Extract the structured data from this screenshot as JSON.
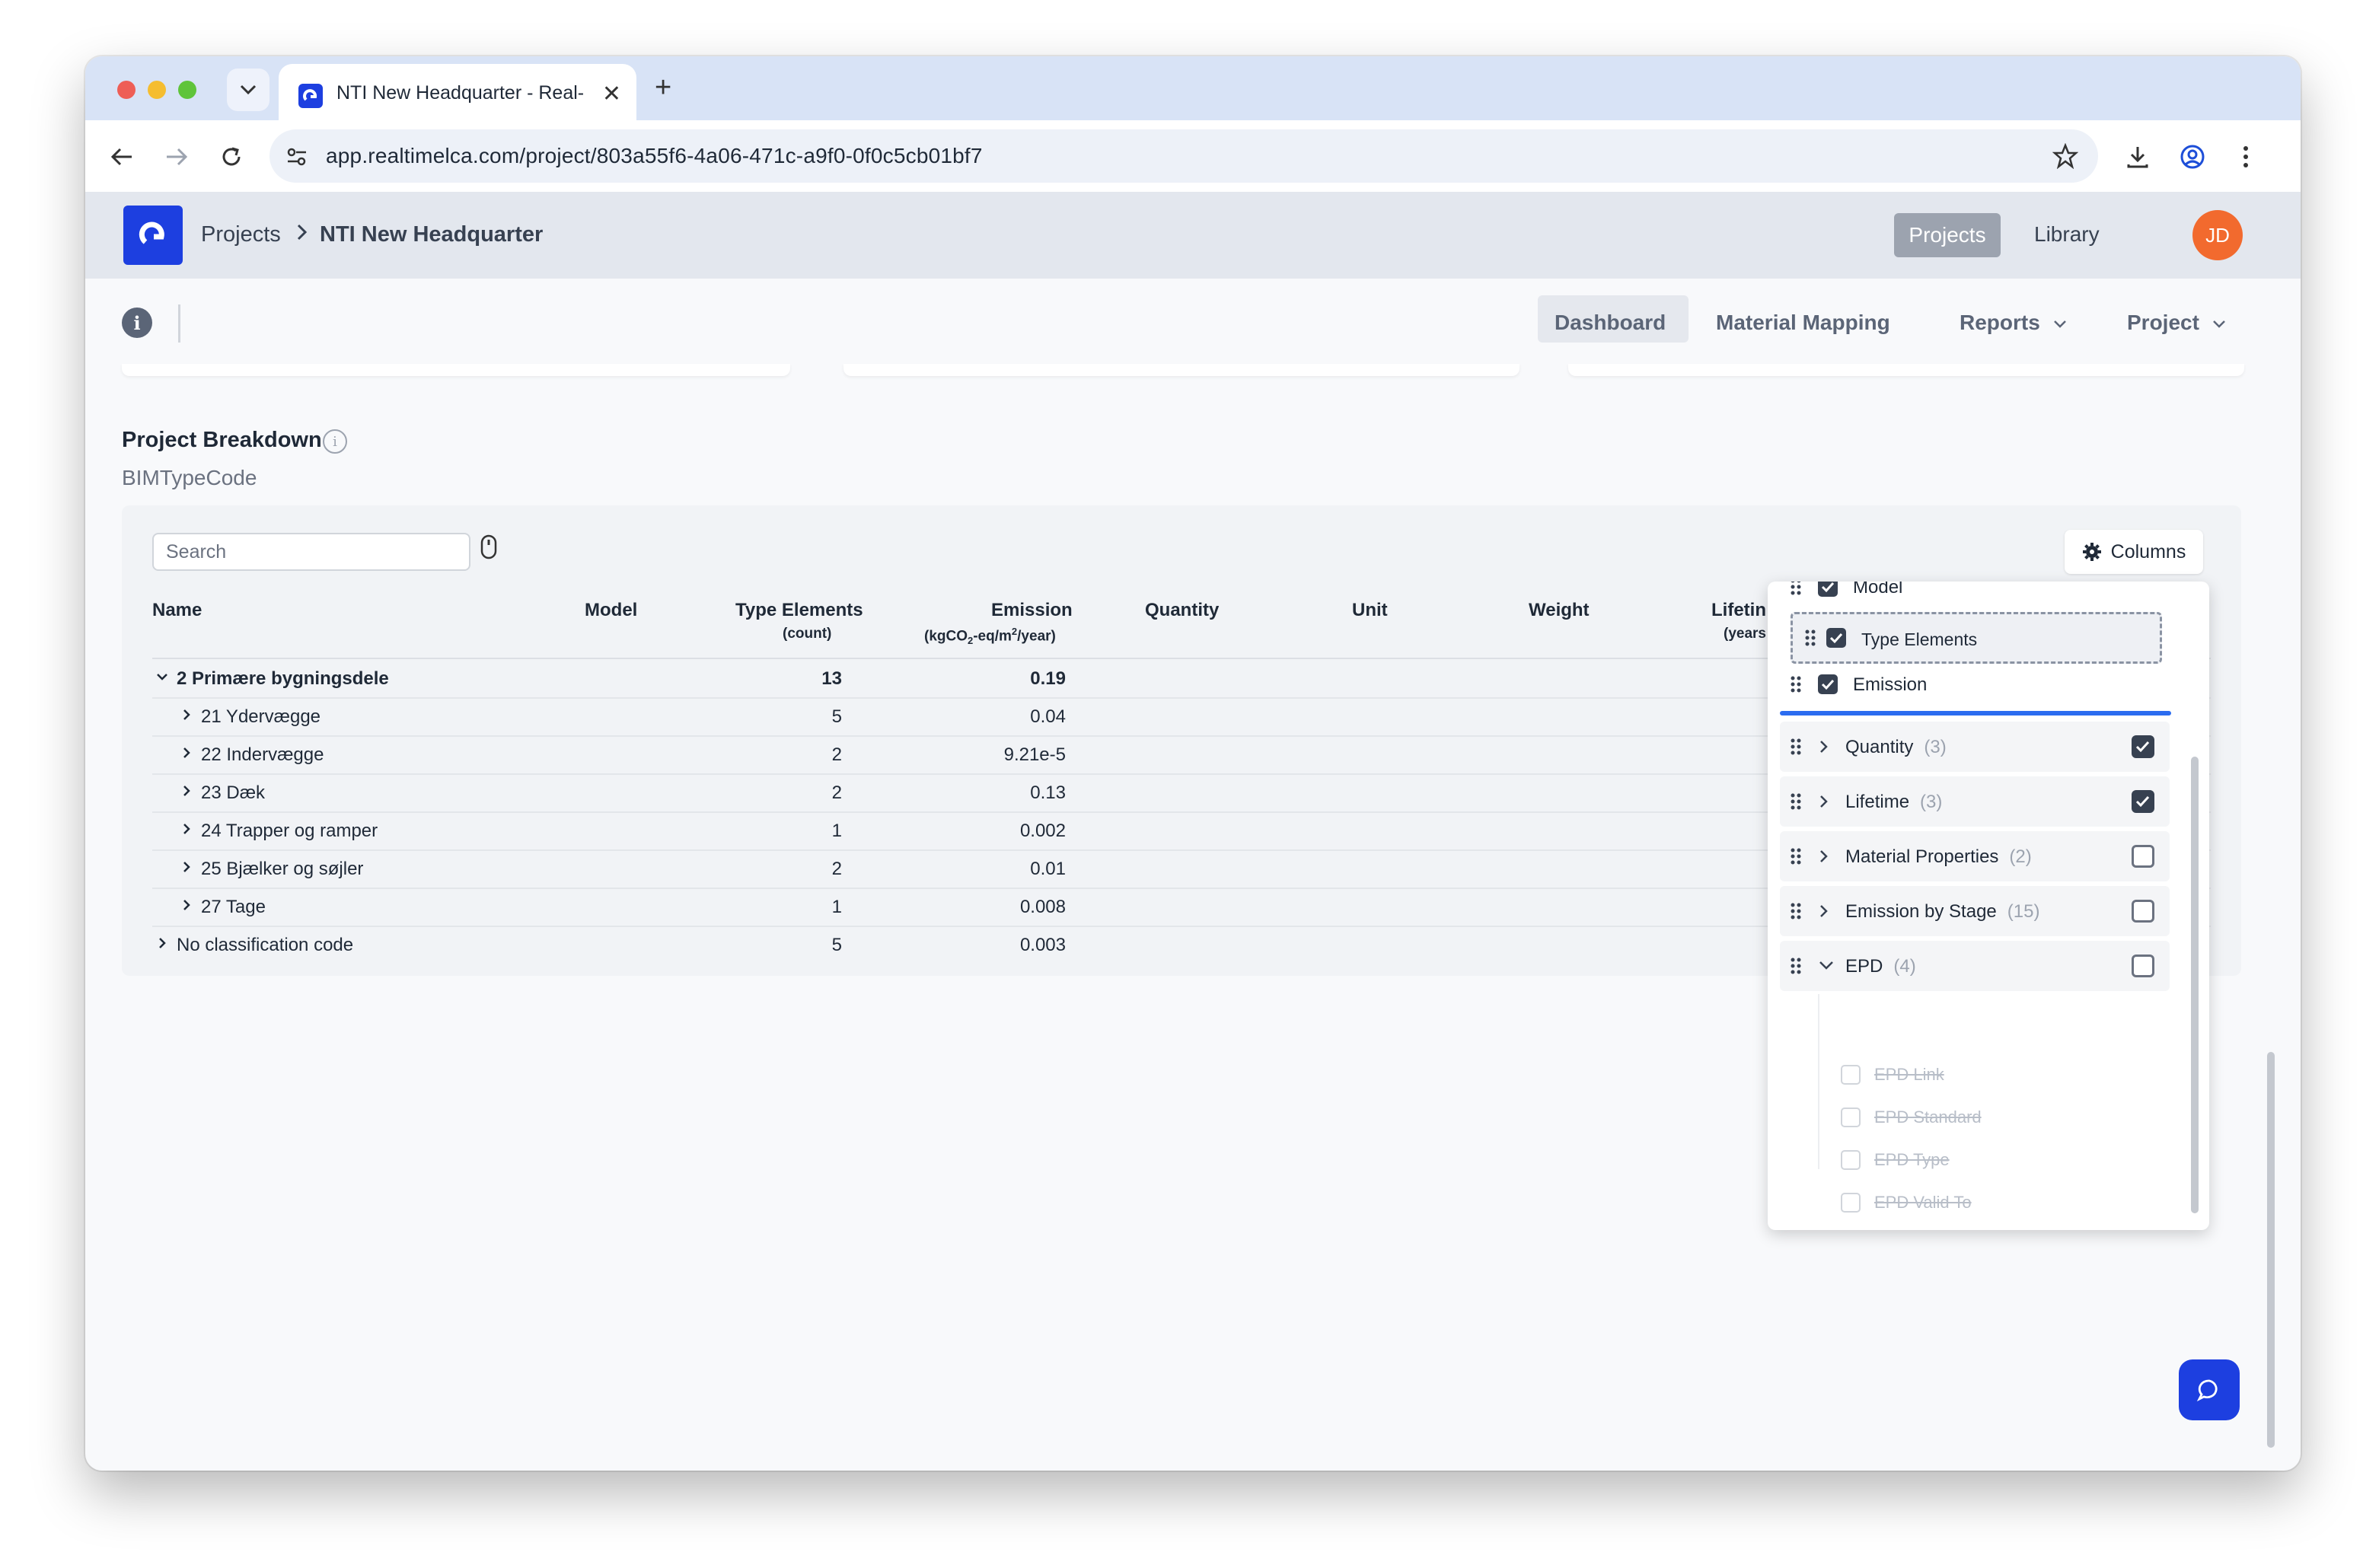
{
  "browser": {
    "tab_title": "NTI New Headquarter - Real-",
    "url": "app.realtimelca.com/project/803a55f6-4a06-471c-a9f0-0f0c5cb01bf7"
  },
  "header": {
    "breadcrumb": [
      "Projects",
      "NTI New Headquarter"
    ],
    "nav": [
      "Projects",
      "Library"
    ],
    "avatar_initials": "JD"
  },
  "subnav": {
    "items": [
      "Dashboard",
      "Material Mapping",
      "Reports",
      "Project"
    ]
  },
  "section": {
    "title": "Project Breakdown",
    "subtitle": "BIMTypeCode",
    "search_placeholder": "Search",
    "columns_label": "Columns"
  },
  "table": {
    "headers": {
      "name": "Name",
      "model": "Model",
      "type_elements": "Type Elements",
      "type_elements_unit": "(count)",
      "emission": "Emission",
      "emission_unit_a": "(kgCO",
      "emission_unit_sub": "2",
      "emission_unit_b": "-eq/m",
      "emission_unit_sup": "2",
      "emission_unit_c": "/year)",
      "quantity": "Quantity",
      "unit": "Unit",
      "weight": "Weight",
      "lifetime": "Lifetin",
      "lifetime_unit": "(years"
    },
    "rows": [
      {
        "name": "2 Primære bygningsdele",
        "count": "13",
        "emission": "0.19"
      },
      {
        "name": "21 Ydervægge",
        "count": "5",
        "emission": "0.04"
      },
      {
        "name": "22 Indervægge",
        "count": "2",
        "emission": "9.21e-5"
      },
      {
        "name": "23 Dæk",
        "count": "2",
        "emission": "0.13"
      },
      {
        "name": "24 Trapper og ramper",
        "count": "1",
        "emission": "0.002"
      },
      {
        "name": "25 Bjælker og søjler",
        "count": "2",
        "emission": "0.01"
      },
      {
        "name": "27 Tage",
        "count": "1",
        "emission": "0.008"
      },
      {
        "name": "No classification code",
        "count": "5",
        "emission": "0.003"
      }
    ]
  },
  "columns_popover": {
    "top_items": [
      "Model",
      "Type Elements",
      "Emission"
    ],
    "groups": [
      {
        "label": "Quantity",
        "count": "(3)",
        "checked": true
      },
      {
        "label": "Lifetime",
        "count": "(3)",
        "checked": true
      },
      {
        "label": "Material Properties",
        "count": "(2)",
        "checked": false
      },
      {
        "label": "Emission by Stage",
        "count": "(15)",
        "checked": false
      },
      {
        "label": "EPD",
        "count": "(4)",
        "checked": false
      }
    ],
    "epd_children": [
      "EPD Link",
      "EPD Standard",
      "EPD Type",
      "EPD Valid To"
    ]
  },
  "colors": {
    "brand": "#1d3fe0",
    "avatar": "#f26a2e",
    "drop_indicator": "#2b6cf0"
  }
}
